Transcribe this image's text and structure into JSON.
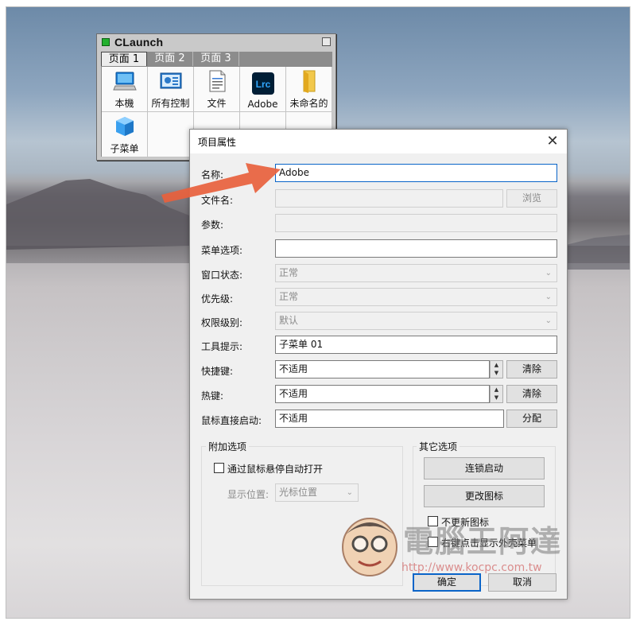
{
  "claunch": {
    "title": "CLaunch",
    "tabs": [
      "页面 1",
      "页面 2",
      "页面 3"
    ],
    "items": [
      {
        "label": "本機",
        "icon": "computer-icon"
      },
      {
        "label": "所有控制",
        "icon": "control-panel-icon"
      },
      {
        "label": "文件",
        "icon": "document-icon"
      },
      {
        "label": "Adobe",
        "icon": "lightroom-icon",
        "icon_text": "Lrc"
      },
      {
        "label": "未命名的",
        "icon": "folder-icon"
      },
      {
        "label": "子菜单",
        "icon": "submenu-cube-icon"
      }
    ]
  },
  "dialog": {
    "title": "项目属性",
    "name_label": "名称:",
    "name_value": "Adobe",
    "filename_label": "文件名:",
    "browse_label": "浏览",
    "params_label": "参数:",
    "menu_option_label": "菜单选项:",
    "window_state_label": "窗口状态:",
    "window_state_value": "正常",
    "priority_label": "优先级:",
    "priority_value": "正常",
    "permission_label": "权限级别:",
    "permission_value": "默认",
    "tooltip_label": "工具提示:",
    "tooltip_value": "子菜单 01",
    "shortcut_label": "快捷键:",
    "shortcut_value": "不适用",
    "hotkey_label": "热键:",
    "hotkey_value": "不适用",
    "mouse_label": "鼠标直接启动:",
    "mouse_value": "不适用",
    "clear_label": "清除",
    "assign_label": "分配",
    "extra_group": "附加选项",
    "hover_open_label": "通过鼠标悬停自动打开",
    "display_pos_label": "显示位置:",
    "display_pos_value": "光标位置",
    "other_group": "其它选项",
    "chain_launch_label": "连锁启动",
    "change_icon_label": "更改图标",
    "no_update_icon_label": "不更新图标",
    "right_click_label": "右键点击显示外壳菜单",
    "ok_label": "确定",
    "cancel_label": "取消"
  },
  "watermark": {
    "text": "電腦王阿達",
    "url": "http://www.kocpc.com.tw"
  },
  "colors": {
    "annotation_arrow": "#e8613d",
    "focus_border": "#0a64c8"
  }
}
